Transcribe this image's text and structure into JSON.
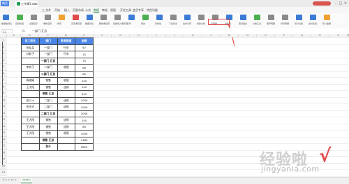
{
  "app": {
    "button": "稿壳",
    "doc_tab": "工作簿1.xlsx",
    "close": "×"
  },
  "menu": [
    "三 文件",
    "开始",
    "插入",
    "页面布局",
    "公式",
    "数据",
    "审阅",
    "视图",
    "开发工具",
    "会员专享",
    "特色功能"
  ],
  "ribbon_buttons": [
    "数据透视表",
    "自动筛选",
    "全部显示",
    "重新应用",
    "排序",
    "高亮重复项",
    "数据对比",
    "删除重复项",
    "拒绝录入重复项",
    "分列",
    "填充",
    "有效性",
    "下拉列表",
    "合并计算",
    "模拟分析",
    "记录单",
    "创建组",
    "取消组合",
    "分类汇总",
    "展开明细",
    "折叠明细",
    "拆分表格",
    "合并表格",
    "导入数据"
  ],
  "formula_bar": {
    "cell": "C2",
    "fx": "fx",
    "value": "一部门 汇总"
  },
  "columns": [
    "A",
    "B",
    "C",
    "D",
    "E",
    "F",
    "G",
    "H",
    "I",
    "J",
    "K",
    "L",
    "M",
    "N",
    "O",
    "P",
    "Q",
    "R",
    "S",
    "T",
    "U",
    "V",
    "W",
    "X",
    "Y"
  ],
  "rows": [
    "1",
    "2",
    "3",
    "4",
    "5",
    "6",
    "7",
    "8",
    "9",
    "10",
    "11",
    "12",
    "13",
    "14",
    "15",
    "16",
    "17",
    "18",
    "19",
    "20",
    "21"
  ],
  "table": {
    "headers": [
      "员工姓名",
      "部门",
      "教育程度",
      "金额"
    ],
    "rows": [
      [
        "张友兵",
        "一部门",
        "行车",
        "67"
      ],
      [
        "刘彩子",
        "一部门",
        "行车",
        "75"
      ],
      [
        "",
        "一部门 汇总",
        "",
        "75"
      ],
      [
        "李肖子",
        "二部门",
        "收银",
        "80"
      ],
      [
        "",
        "二部门 汇总",
        "",
        "80"
      ],
      [
        "周晓娟",
        "销售",
        "收银",
        "250"
      ],
      [
        "王大阳",
        "销售",
        "送餐",
        "100"
      ],
      [
        "",
        "销售 汇总",
        "",
        "350"
      ],
      [
        "邵三十",
        "二部门",
        "送餐",
        "1000"
      ],
      [
        "张天天",
        "二部门",
        "送餐",
        "1000"
      ],
      [
        "",
        "二部门 汇总",
        "",
        "2000"
      ],
      [
        "王大阳",
        "销售",
        "送餐",
        "100"
      ],
      [
        "王大阳",
        "销售",
        "送餐",
        "80"
      ],
      [
        "王大阳",
        "销售",
        "收银",
        "1000"
      ],
      [
        "",
        "销售 汇总",
        "",
        "1180"
      ],
      [
        "",
        "总计",
        "",
        "3825"
      ]
    ]
  },
  "sheet": {
    "tab": "Sheet1",
    "nav": "K < > >|  +"
  },
  "watermark": {
    "text": "经验啦",
    "check": "√",
    "url": "jingyanla.com"
  }
}
